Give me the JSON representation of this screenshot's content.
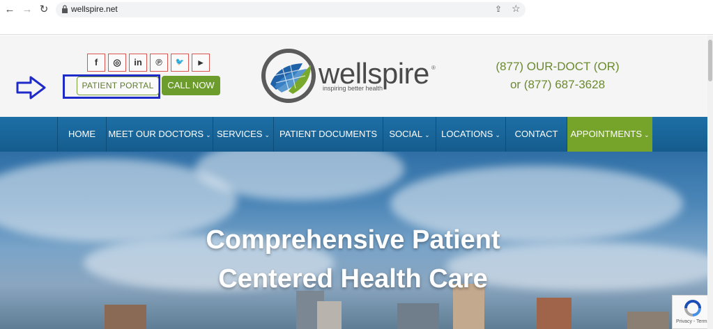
{
  "browser": {
    "url": "wellspire.net",
    "back_icon": "arrow-left",
    "forward_icon": "arrow-right",
    "reload_icon": "reload"
  },
  "header": {
    "social_icons": [
      "facebook",
      "instagram",
      "linkedin",
      "pinterest",
      "twitter",
      "youtube"
    ],
    "social_glyphs": [
      "f",
      "◎",
      "in",
      "℗",
      "🐦",
      "▶"
    ],
    "patient_portal_label": "PATIENT PORTAL",
    "call_now_label": "CALL NOW",
    "logo_text": "wellspire",
    "logo_reg": "®",
    "logo_tagline": "inspiring better health",
    "phone_line1": "(877) OUR-DOCT (OR)",
    "phone_line2": "or (877) 687-3628"
  },
  "nav": {
    "items": [
      {
        "label": "HOME",
        "has_dropdown": false
      },
      {
        "label": "MEET OUR DOCTORS",
        "has_dropdown": true
      },
      {
        "label": "SERVICES",
        "has_dropdown": true
      },
      {
        "label": "PATIENT DOCUMENTS",
        "has_dropdown": false
      },
      {
        "label": "SOCIAL",
        "has_dropdown": true
      },
      {
        "label": "LOCATIONS",
        "has_dropdown": true
      },
      {
        "label": "CONTACT",
        "has_dropdown": false
      },
      {
        "label": "APPOINTMENTS",
        "has_dropdown": true
      }
    ],
    "chevron": "⌄"
  },
  "hero": {
    "title_line1": "Comprehensive Patient",
    "title_line2": "Centered Health Care"
  },
  "recaptcha": {
    "text": "Privacy - Terms"
  },
  "colors": {
    "nav_bg": "#1d6fa6",
    "accent_green": "#76a32a",
    "phone_green": "#6b8a2e",
    "highlight_blue": "#1f2bc9"
  }
}
